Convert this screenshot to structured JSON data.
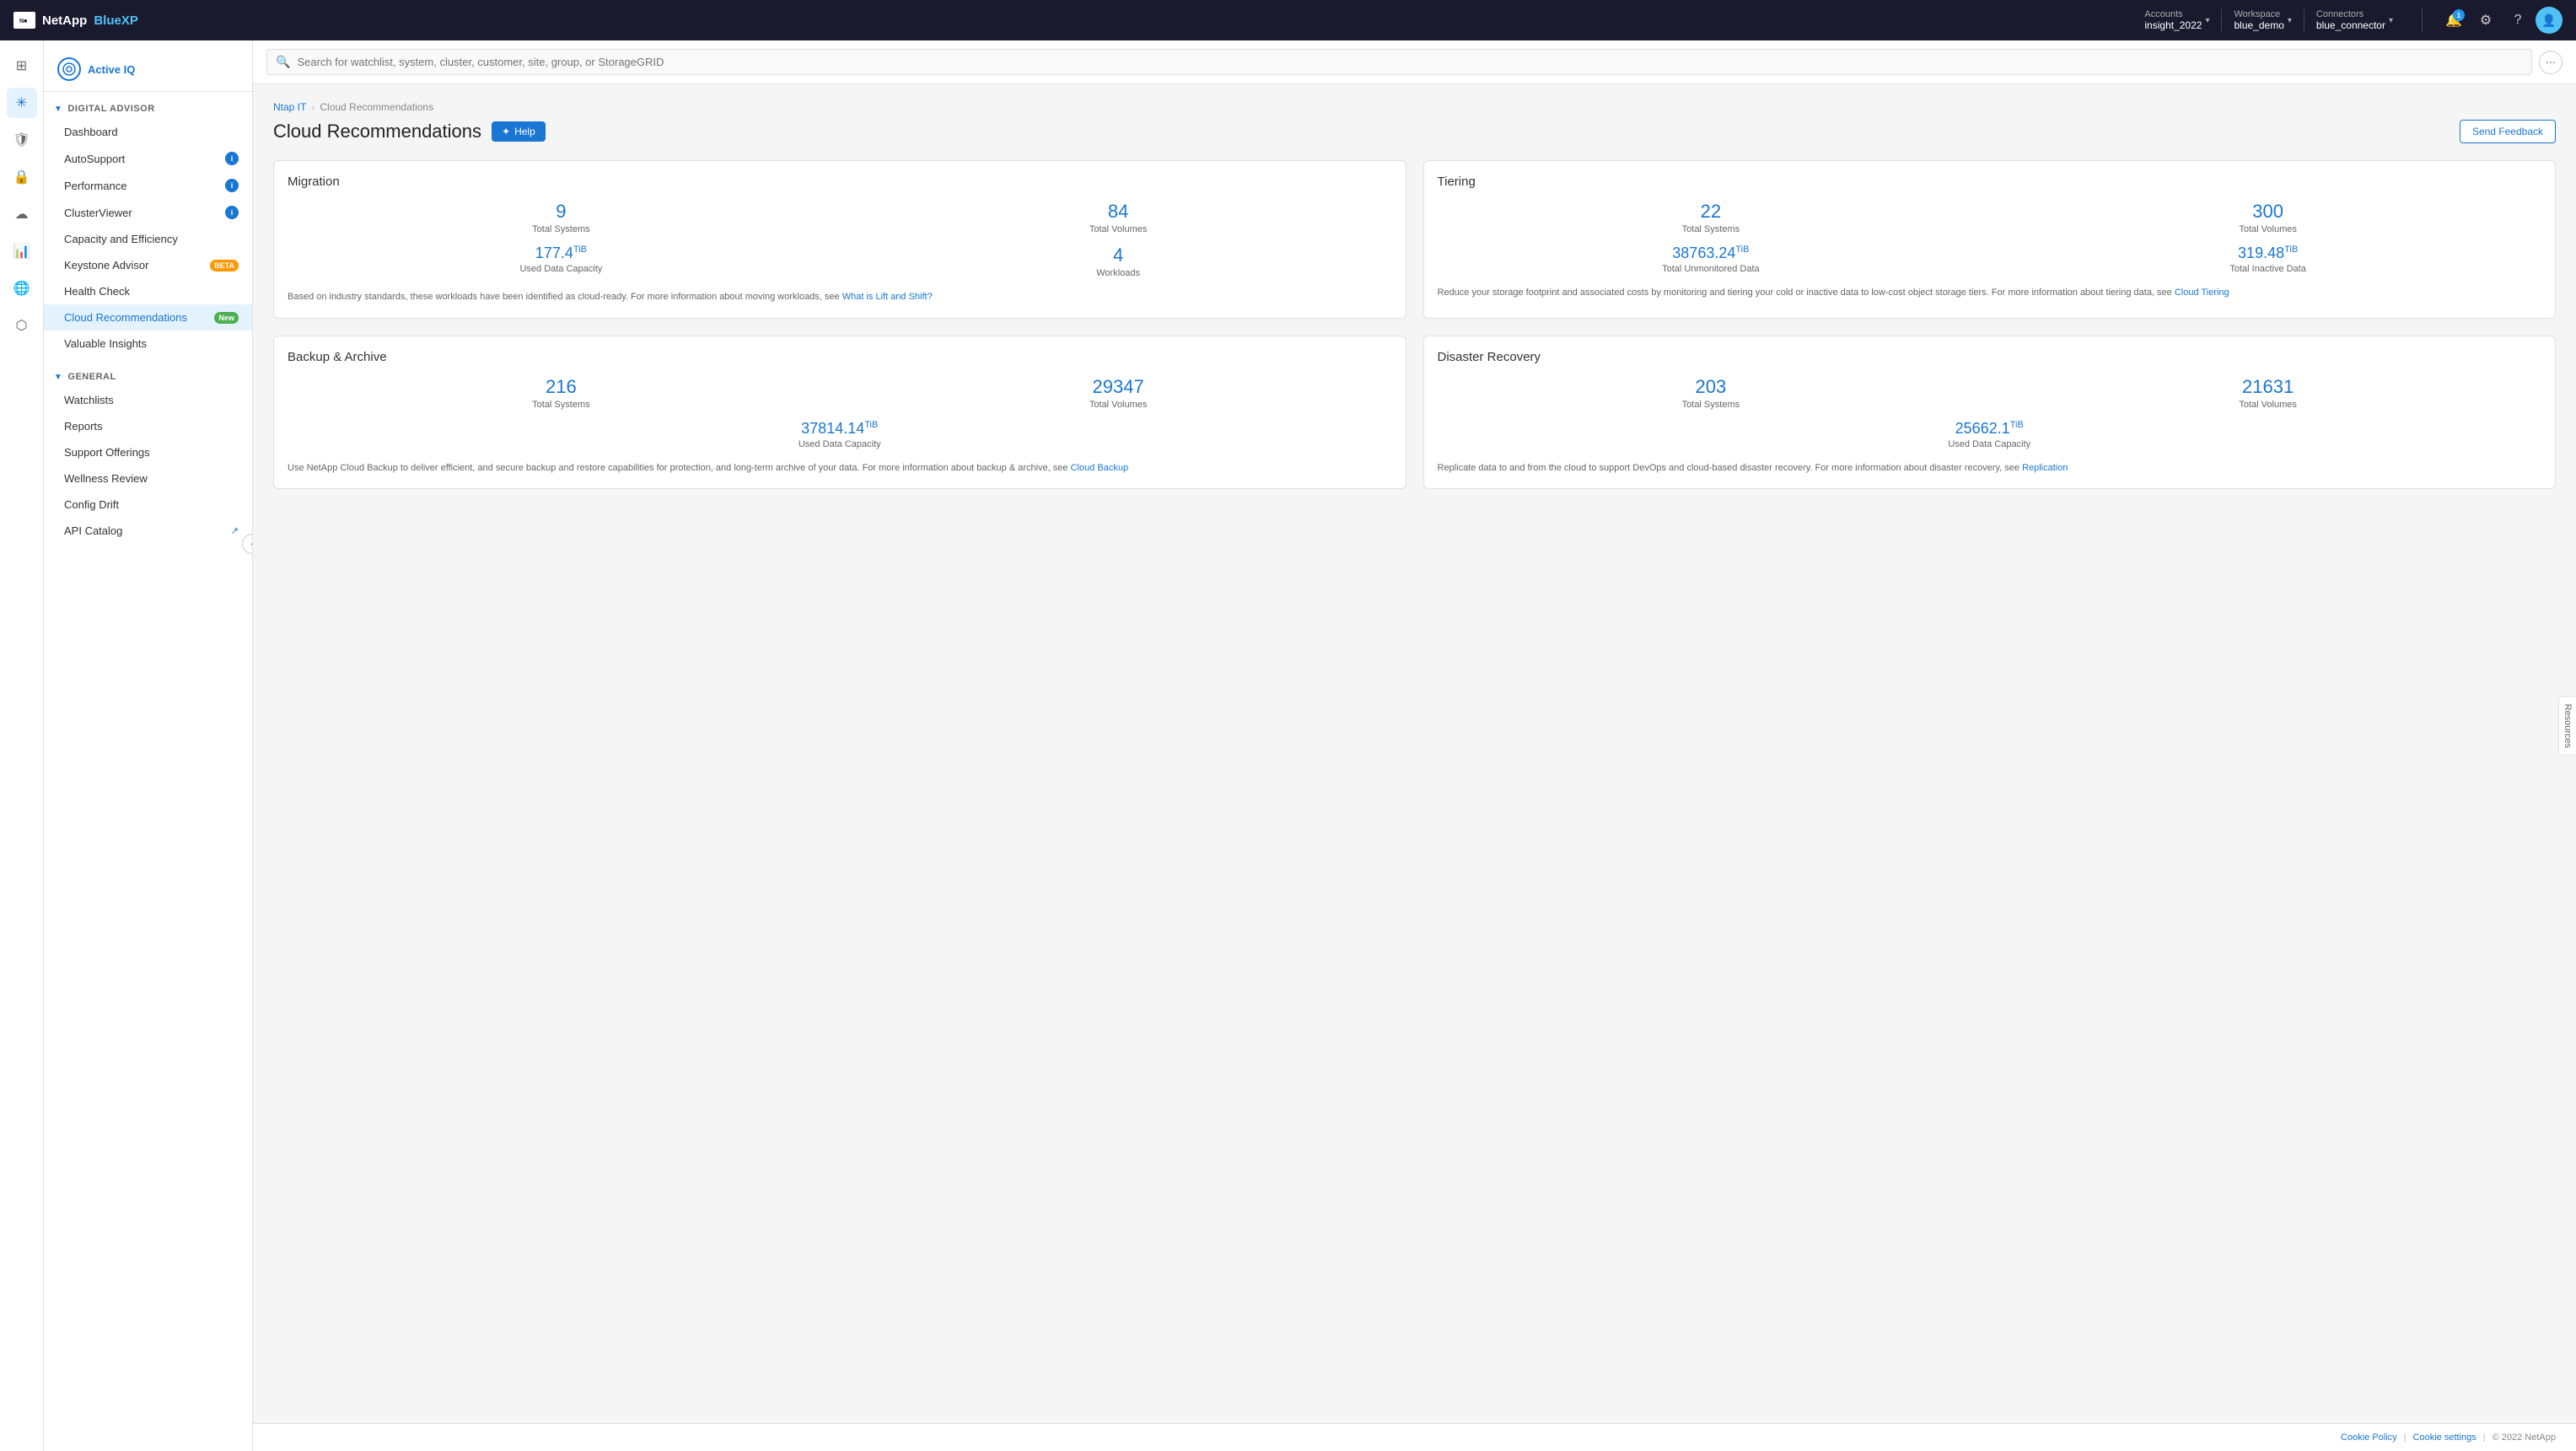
{
  "topnav": {
    "logo_text": "NetApp",
    "app_name": "BlueXP",
    "logo_icon": "N",
    "accounts": {
      "label": "Accounts",
      "value": "insight_2022"
    },
    "workspace": {
      "label": "Workspace",
      "value": "blue_demo"
    },
    "connectors": {
      "label": "Connectors",
      "value": "blue_connector"
    },
    "notification_count": "1"
  },
  "search": {
    "placeholder": "Search for watchlist, system, cluster, customer, site, group, or StorageGRID"
  },
  "breadcrumb": {
    "parent": "Ntap IT",
    "current": "Cloud Recommendations"
  },
  "page": {
    "title": "Cloud Recommendations",
    "help_label": "Help",
    "send_feedback": "Send Feedback"
  },
  "sidebar": {
    "active_iq_label": "Active IQ",
    "digital_advisor_label": "DIGITAL ADVISOR",
    "sections": {
      "digital_advisor": {
        "items": [
          {
            "id": "dashboard",
            "label": "Dashboard",
            "badge": null
          },
          {
            "id": "autosupport",
            "label": "AutoSupport",
            "badge": "info"
          },
          {
            "id": "performance",
            "label": "Performance",
            "badge": "info"
          },
          {
            "id": "clusterviewer",
            "label": "ClusterViewer",
            "badge": "info"
          },
          {
            "id": "capacity",
            "label": "Capacity and Efficiency",
            "badge": null
          },
          {
            "id": "keystone",
            "label": "Keystone Advisor",
            "badge": "beta"
          },
          {
            "id": "healthcheck",
            "label": "Health Check",
            "badge": null
          },
          {
            "id": "cloud",
            "label": "Cloud Recommendations",
            "badge": "new",
            "active": true
          },
          {
            "id": "valuable",
            "label": "Valuable Insights",
            "badge": null
          }
        ]
      },
      "general": {
        "label": "GENERAL",
        "items": [
          {
            "id": "watchlists",
            "label": "Watchlists"
          },
          {
            "id": "reports",
            "label": "Reports"
          },
          {
            "id": "support",
            "label": "Support Offerings"
          },
          {
            "id": "wellness",
            "label": "Wellness Review"
          },
          {
            "id": "config",
            "label": "Config Drift"
          },
          {
            "id": "api",
            "label": "API Catalog",
            "external": true
          }
        ]
      }
    }
  },
  "migration": {
    "title": "Migration",
    "total_systems_value": "9",
    "total_systems_label": "Total Systems",
    "total_volumes_value": "84",
    "total_volumes_label": "Total Volumes",
    "used_capacity_value": "177.4",
    "used_capacity_unit": "TiB",
    "used_capacity_label": "Used Data Capacity",
    "workloads_value": "4",
    "workloads_label": "Workloads",
    "description": "Based on industry standards, these workloads have been identified as cloud-ready. For more information about moving workloads, see ",
    "link_text": "What is Lift and Shift?",
    "link_href": "#"
  },
  "tiering": {
    "title": "Tiering",
    "total_systems_value": "22",
    "total_systems_label": "Total Systems",
    "total_volumes_value": "300",
    "total_volumes_label": "Total Volumes",
    "unmonitored_value": "38763.24",
    "unmonitored_unit": "TiB",
    "unmonitored_label": "Total Unmonitored Data",
    "inactive_value": "319.48",
    "inactive_unit": "TiB",
    "inactive_label": "Total Inactive Data",
    "description": "Reduce your storage footprint and associated costs by monitoring and tiering your cold or inactive data to low-cost object storage tiers. For more information about tiering data, see ",
    "link_text": "Cloud Tiering",
    "link_href": "#"
  },
  "backup": {
    "title": "Backup & Archive",
    "total_systems_value": "216",
    "total_systems_label": "Total Systems",
    "total_volumes_value": "29347",
    "total_volumes_label": "Total Volumes",
    "used_capacity_value": "37814.14",
    "used_capacity_unit": "TiB",
    "used_capacity_label": "Used Data Capacity",
    "description": "Use NetApp Cloud Backup to deliver efficient, and secure backup and restore capabilities for protection, and long-term archive of your data. For more information about backup & archive, see ",
    "link_text": "Cloud Backup",
    "link_href": "#"
  },
  "disaster": {
    "title": "Disaster Recovery",
    "total_systems_value": "203",
    "total_systems_label": "Total Systems",
    "total_volumes_value": "21631",
    "total_volumes_label": "Total Volumes",
    "used_capacity_value": "25662.1",
    "used_capacity_unit": "TiB",
    "used_capacity_label": "Used Data Capacity",
    "description": "Replicate data to and from the cloud to support DevOps and cloud-based disaster recovery. For more information about disaster recovery, see ",
    "link_text": "Replication",
    "link_href": "#"
  },
  "footer": {
    "cookie_policy": "Cookie Policy",
    "cookie_settings": "Cookie settings",
    "copyright": "© 2022 NetApp"
  },
  "resources_tab": "Resources"
}
